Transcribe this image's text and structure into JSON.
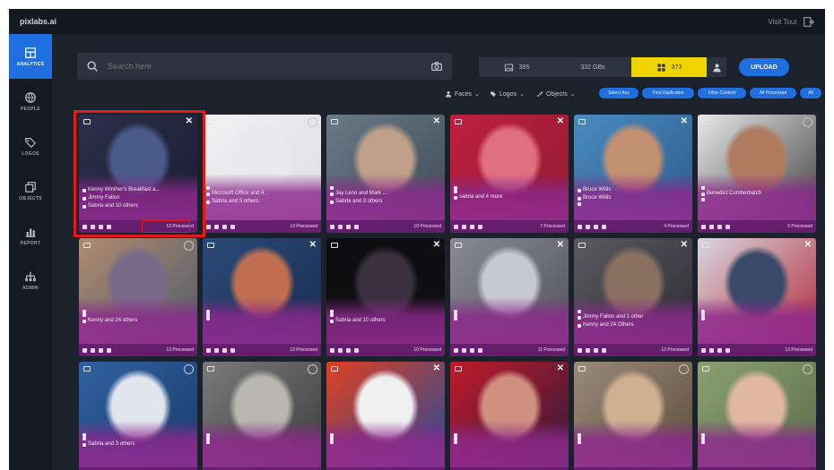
{
  "app": {
    "brand": "pixlabs.ai",
    "tour_label": "Visit Tour"
  },
  "sidebar": {
    "items": [
      {
        "label": "ANALYTICS",
        "icon": "dashboard-icon",
        "active": true
      },
      {
        "label": "PEOPLE",
        "icon": "globe-icon",
        "active": false
      },
      {
        "label": "LOGOS",
        "icon": "tag-icon",
        "active": false
      },
      {
        "label": "OBJECTS",
        "icon": "copy-icon",
        "active": false
      },
      {
        "label": "REPORT",
        "icon": "bar-chart-icon",
        "active": false
      },
      {
        "label": "ADMIN",
        "icon": "network-icon",
        "active": false
      }
    ]
  },
  "search": {
    "placeholder": "Search here"
  },
  "stats": [
    {
      "value": "395",
      "icon": "image-icon"
    },
    {
      "value": "332 GBs",
      "icon": ""
    },
    {
      "value": "373",
      "icon": "grid-icon"
    }
  ],
  "upload_label": "UPLOAD",
  "filters": [
    {
      "label": "Faces",
      "icon": "user-icon"
    },
    {
      "label": "Logos",
      "icon": "tag-icon"
    },
    {
      "label": "Objects",
      "icon": "brush-icon"
    }
  ],
  "chips": [
    "Select Any",
    "Find Duplicates",
    "Filter Content",
    "All Processed",
    "All"
  ],
  "cards": [
    {
      "l1": "Kenny Winther's Breakfast a...",
      "l2": "Jimmy Fallon",
      "l3": "Sabria and 10 others",
      "status": "13 Processed",
      "badge": "close",
      "colors": [
        "#2a2f4a",
        "#4a5a8a",
        "#1a1d30"
      ]
    },
    {
      "l1": "",
      "l2": "Microsoft Office and 4 ..",
      "l3": "Sabria and 3 others",
      "status": "13 Processed",
      "badge": "ring",
      "colors": [
        "#f2f2f2",
        "#e9e9ee",
        "#dcdce4"
      ]
    },
    {
      "l1": "",
      "l2": "Jay Leno and Mark ...",
      "l3": "Sabria and 3 others",
      "status": "10 Processed",
      "badge": "close",
      "colors": [
        "#6a7a86",
        "#c0a08a",
        "#3c4a55"
      ]
    },
    {
      "l1": "",
      "l2": "",
      "l3": "sabria and 4 more",
      "status": "7 Processed",
      "badge": "close",
      "colors": [
        "#c02040",
        "#e07080",
        "#8a1a30"
      ]
    },
    {
      "l1": "Bruce Willis",
      "l2": "Bruce Willis",
      "l3": "",
      "status": "4 Processed",
      "badge": "close",
      "colors": [
        "#4a8ac0",
        "#c09070",
        "#2a5a8a"
      ]
    },
    {
      "l1": "",
      "l2": "Benedict Cumberbatch",
      "l3": "",
      "status": "5 Processed",
      "badge": "ring",
      "colors": [
        "#e8e8e8",
        "#b07a60",
        "#3a3a3a"
      ]
    },
    {
      "l1": "",
      "l2": "",
      "l3": "Kenny and 24 others",
      "status": "13 Processed",
      "badge": "ring",
      "colors": [
        "#b08a70",
        "#7a6a8a",
        "#4a5a6a"
      ]
    },
    {
      "l1": "",
      "l2": "",
      "l3": "",
      "status": "13 Processed",
      "badge": "close",
      "colors": [
        "#2a4a7a",
        "#c07050",
        "#1a2a4a"
      ]
    },
    {
      "l1": "",
      "l2": "",
      "l3": "Sabria and 10 others",
      "status": "10 Processed",
      "badge": "close",
      "colors": [
        "#0d0d10",
        "#3a3040",
        "#101014"
      ]
    },
    {
      "l1": "",
      "l2": "",
      "l3": "",
      "status": "11 Processed",
      "badge": "close",
      "colors": [
        "#8a8a94",
        "#c8c8d0",
        "#50505a"
      ]
    },
    {
      "l1": "",
      "l2": "Jimmy Fallon and 1 other",
      "l3": "Kenny and 24 Others",
      "status": "13 Processed",
      "badge": "close",
      "colors": [
        "#5a5a60",
        "#8a7060",
        "#2a2a30"
      ]
    },
    {
      "l1": "",
      "l2": "",
      "l3": "",
      "status": "13 Processed",
      "badge": "close",
      "colors": [
        "#d8d8e0",
        "#3a4a6a",
        "#b02030"
      ]
    },
    {
      "l1": "",
      "l2": "",
      "l3": "Sabria and 3 others",
      "status": "",
      "badge": "ring",
      "colors": [
        "#3060a0",
        "#e0e6ee",
        "#1a3a6a"
      ]
    },
    {
      "l1": "",
      "l2": "",
      "l3": "",
      "status": "",
      "badge": "ring",
      "colors": [
        "#7a7a7a",
        "#b8b8b0",
        "#3a3a3a"
      ]
    },
    {
      "l1": "",
      "l2": "",
      "l3": "",
      "status": "",
      "badge": "close",
      "colors": [
        "#e04020",
        "#f0f0f0",
        "#1a4aa0"
      ]
    },
    {
      "l1": "",
      "l2": "",
      "l3": "",
      "status": "",
      "badge": "close",
      "colors": [
        "#c01a2a",
        "#d09080",
        "#2a1a3a"
      ]
    },
    {
      "l1": "",
      "l2": "",
      "l3": "",
      "status": "",
      "badge": "ring",
      "colors": [
        "#9a8a78",
        "#d0b090",
        "#5a4a3a"
      ]
    },
    {
      "l1": "",
      "l2": "",
      "l3": "",
      "status": "",
      "badge": "ring",
      "colors": [
        "#8aa070",
        "#e0b8a0",
        "#5a6a4a"
      ]
    }
  ],
  "colors": {
    "accent": "#1f6fe0",
    "highlight": "#f0d400",
    "selection": "#e01b1b",
    "card_overlay": "#8c288c"
  }
}
